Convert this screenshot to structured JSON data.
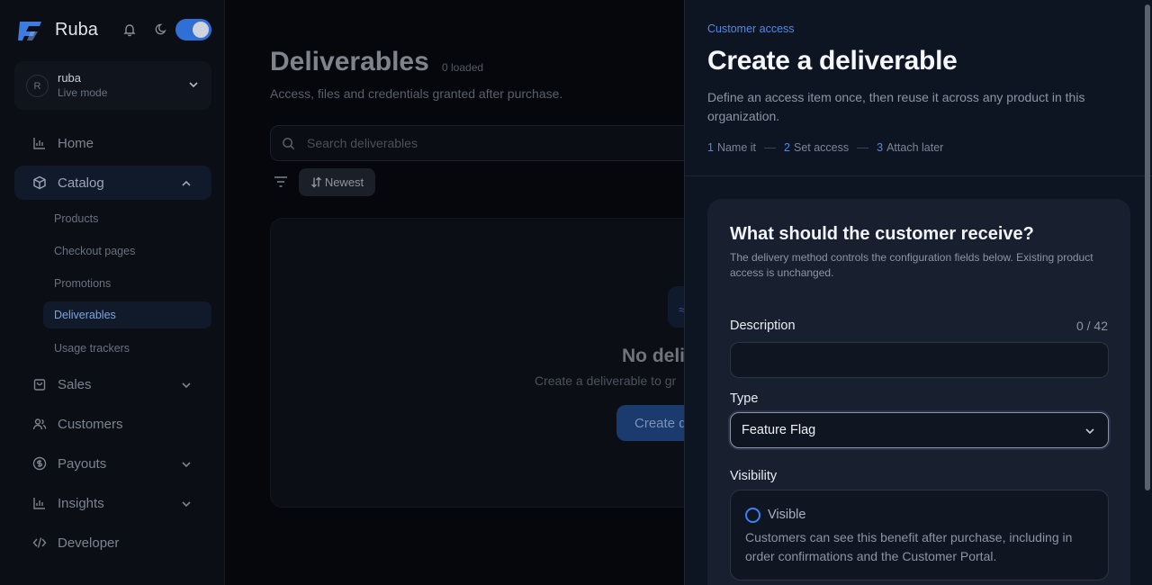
{
  "app": {
    "name": "Ruba"
  },
  "account": {
    "avatar_initial": "R",
    "username": "ruba",
    "mode": "Live mode"
  },
  "nav": {
    "items": [
      {
        "label": "Home",
        "icon": "bar-chart-icon"
      },
      {
        "label": "Catalog",
        "icon": "box-icon"
      },
      {
        "label": "Sales",
        "icon": "shopping-bag-icon"
      },
      {
        "label": "Customers",
        "icon": "users-icon"
      },
      {
        "label": "Payouts",
        "icon": "dollar-icon"
      },
      {
        "label": "Insights",
        "icon": "bar-chart-icon"
      },
      {
        "label": "Developer",
        "icon": "code-icon"
      }
    ],
    "catalog_subitems": [
      "Products",
      "Checkout pages",
      "Promotions",
      "Deliverables",
      "Usage trackers"
    ]
  },
  "main": {
    "title": "Deliverables",
    "loaded": "0 loaded",
    "subtitle": "Access, files and credentials granted after purchase.",
    "search_placeholder": "Search deliverables",
    "sort_label": "Newest",
    "empty_title": "No deliv",
    "empty_sub": "Create a deliverable to gr",
    "empty_button": "Create d"
  },
  "drawer": {
    "eyebrow": "Customer access",
    "title": "Create a deliverable",
    "description": "Define an access item once, then reuse it across any product in this organization.",
    "steps": [
      {
        "num": "1",
        "label": "Name it"
      },
      {
        "num": "2",
        "label": "Set access"
      },
      {
        "num": "3",
        "label": "Attach later"
      }
    ],
    "card": {
      "question": "What should the customer receive?",
      "question_desc": "The delivery method controls the configuration fields below. Existing product access is unchanged.",
      "description_label": "Description",
      "description_counter": "0 / 42",
      "description_value": "",
      "type_label": "Type",
      "type_value": "Feature Flag",
      "visibility_label": "Visibility",
      "visibility_option": "Visible",
      "visibility_desc": "Customers can see this benefit after purchase, including in order confirmations and the Customer Portal."
    }
  },
  "colors": {
    "accent": "#3b82f6",
    "toggle": "#2f6fd6"
  }
}
